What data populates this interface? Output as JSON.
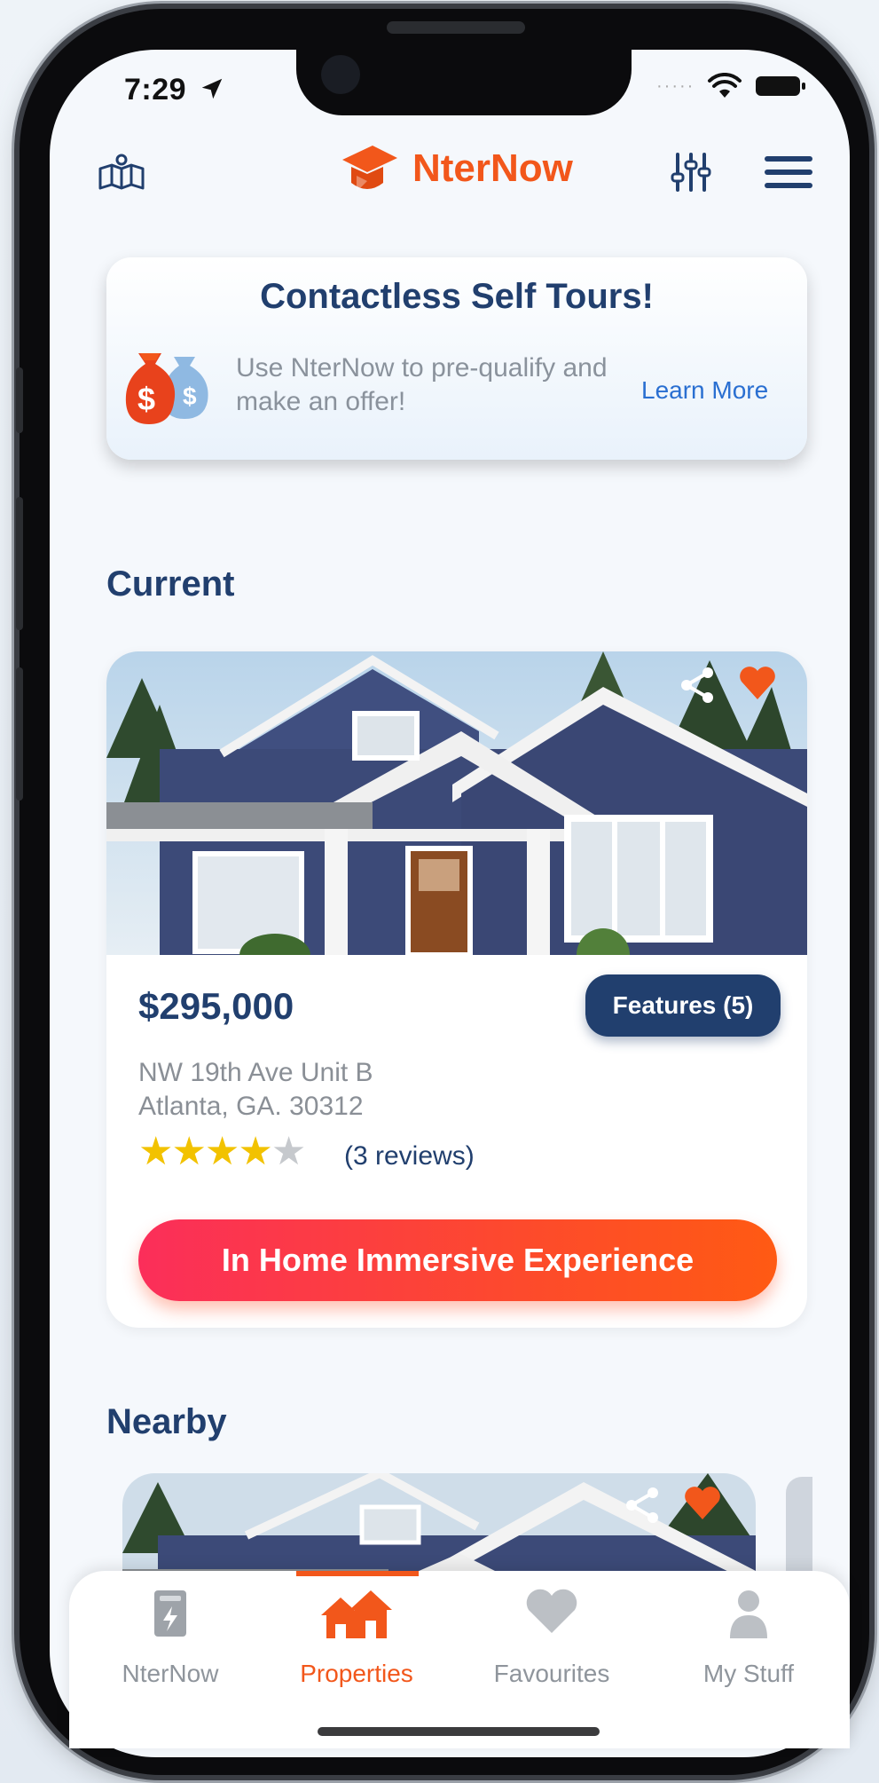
{
  "status_bar": {
    "time": "7:29"
  },
  "header": {
    "app_name": "NterNow"
  },
  "banner": {
    "title": "Contactless Self Tours!",
    "description": "Use NterNow to pre-qualify and make an offer!",
    "link_label": "Learn More"
  },
  "current": {
    "section_title": "Current",
    "price": "$295,000",
    "features_label": "Features (5)",
    "address_line1": "NW 19th Ave Unit B",
    "address_line2": "Atlanta, GA. 30312",
    "rating": 4,
    "rating_max": 5,
    "reviews": "(3 reviews)",
    "cta_label": "In Home Immersive Experience"
  },
  "nearby": {
    "section_title": "Nearby"
  },
  "tabbar": {
    "items": [
      {
        "label": "NterNow",
        "icon": "fuse-box-icon"
      },
      {
        "label": "Properties",
        "icon": "houses-icon"
      },
      {
        "label": "Favourites",
        "icon": "heart-icon"
      },
      {
        "label": "My Stuff",
        "icon": "person-icon"
      }
    ],
    "active_index": 1
  },
  "colors": {
    "brand_orange": "#f2571b",
    "navy": "#213f6e",
    "cta_start": "#fb2e5a",
    "cta_end": "#ff5a13",
    "star_gold": "#f2c200"
  }
}
